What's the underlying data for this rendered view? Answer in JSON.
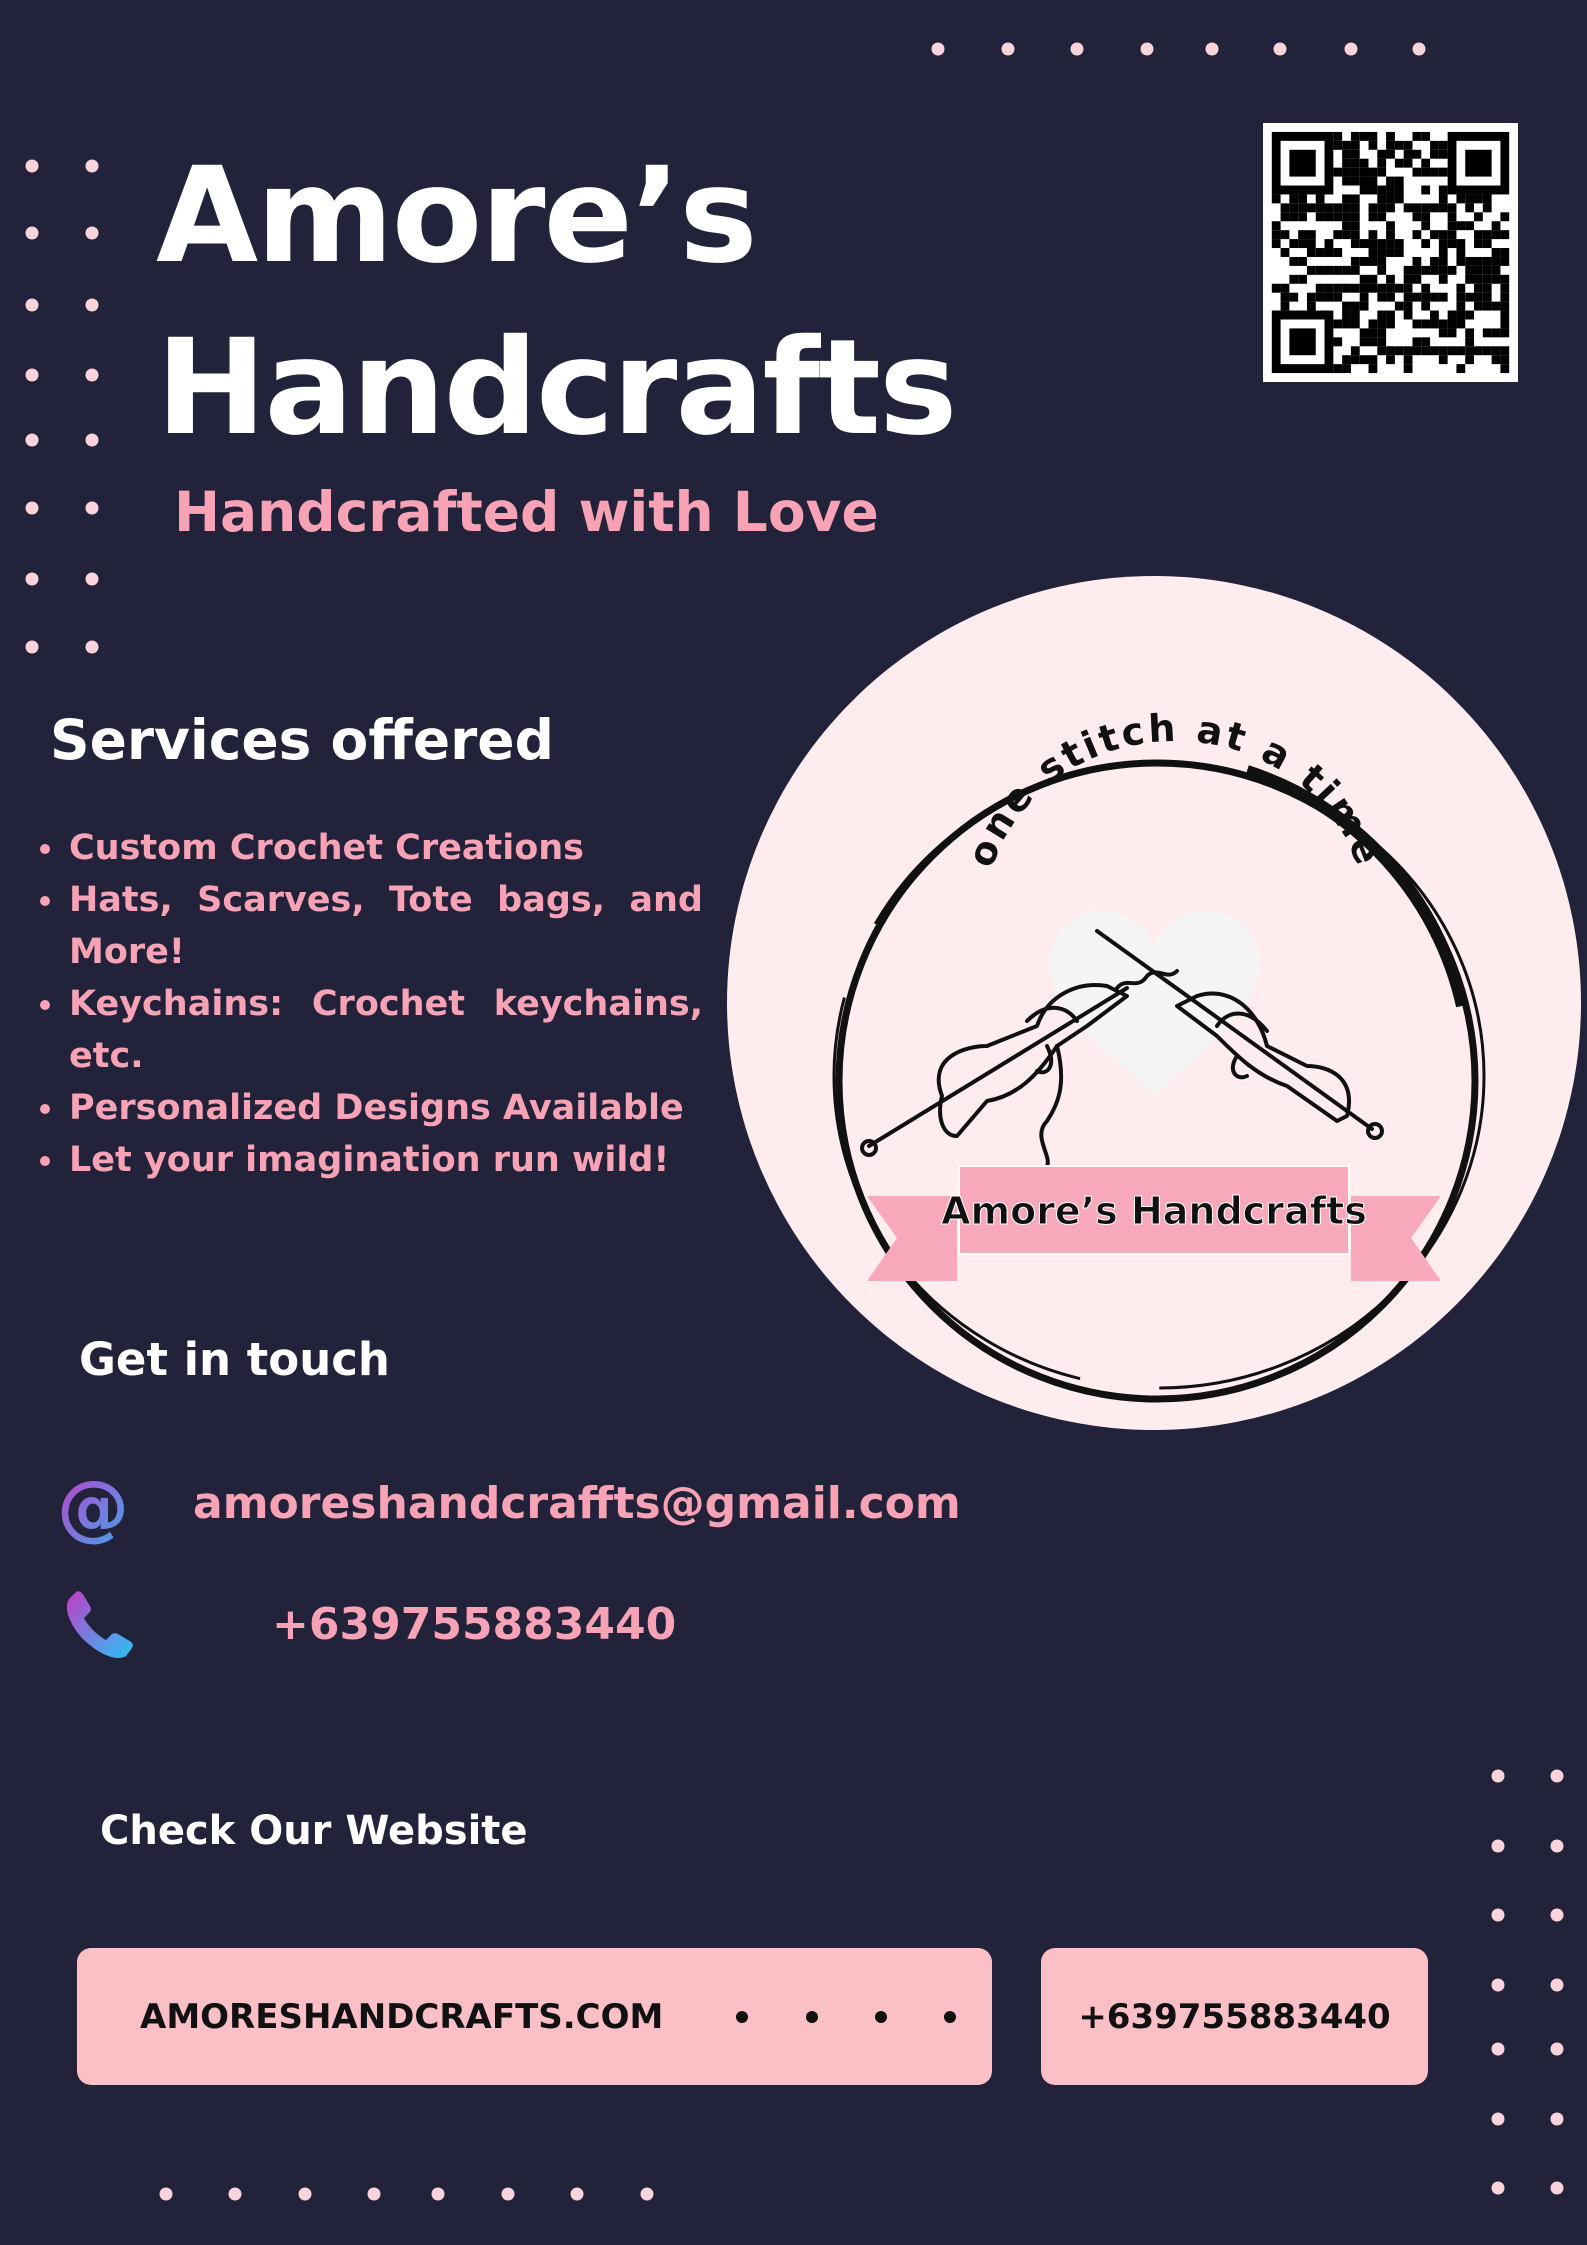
{
  "header": {
    "title_line1": "Amore’s",
    "title_line2": "Handcrafts",
    "tagline": "Handcrafted with Love"
  },
  "qr_code": {
    "icon": "qr-code"
  },
  "logo": {
    "arc_text": "one stitch at a time",
    "ribbon_text": "Amore’s Handcrafts",
    "colors": {
      "background": "#ffecef",
      "ribbon": "#f7a9bb",
      "heart": "#f5f5f5"
    }
  },
  "services": {
    "heading": "Services offered",
    "items": [
      "Custom Crochet Creations",
      "Hats, Scarves, Tote bags, and More!",
      "Keychains: Crochet keychains, etc.",
      "Personalized Designs Available",
      "Let your imagination run wild!"
    ]
  },
  "contact": {
    "heading": "Get in touch",
    "email": "amoreshandcraffts@gmail.com",
    "email_icon": "at-sign-icon",
    "phone": "+639755883440",
    "phone_icon": "phone-icon"
  },
  "website": {
    "heading": "Check Our Website",
    "url_button": "AMORESHANDCRAFTS.COM",
    "phone_button": "+639755883440"
  },
  "colors": {
    "background": "#22223a",
    "accent_pink": "#f7a3b5",
    "button_pink": "#fbbfc6",
    "dots": "#fbd3da"
  }
}
